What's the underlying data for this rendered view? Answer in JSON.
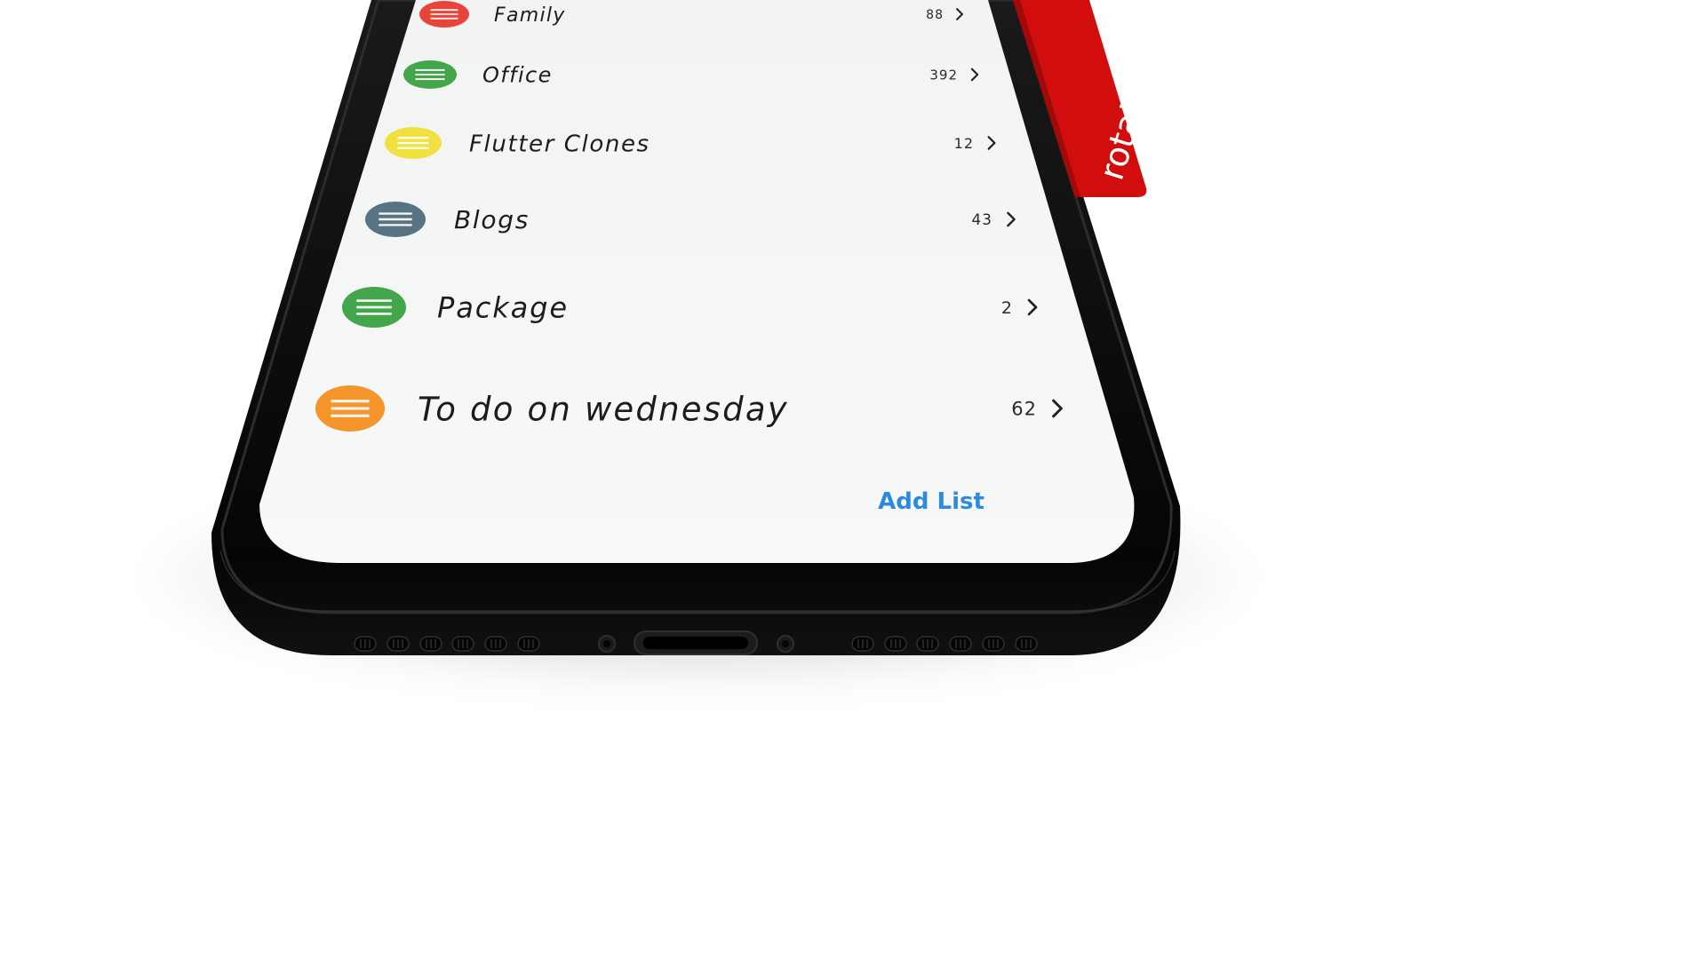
{
  "lists": [
    {
      "label": "Family",
      "count": "88",
      "color": "#e8443a",
      "icon": "list-lines-icon"
    },
    {
      "label": "Office",
      "count": "392",
      "color": "#43a64a",
      "icon": "list-lines-icon"
    },
    {
      "label": "Flutter Clones",
      "count": "12",
      "color": "#f0e040",
      "icon": "list-lines-icon"
    },
    {
      "label": "Blogs",
      "count": "43",
      "color": "#587482",
      "icon": "list-lines-icon"
    },
    {
      "label": "Package",
      "count": "2",
      "color": "#43a64a",
      "icon": "list-lines-icon"
    },
    {
      "label": "To do on wednesday",
      "count": "62",
      "color": "#f5962c",
      "icon": "list-lines-icon"
    }
  ],
  "add_list_label": "Add List",
  "watermark": "rotato.xyz/fre",
  "colors": {
    "screen_bg": "#f4f5f5",
    "frame": "#0c0c0c",
    "accent": "#2b8be0",
    "banner": "#d10d0d"
  }
}
